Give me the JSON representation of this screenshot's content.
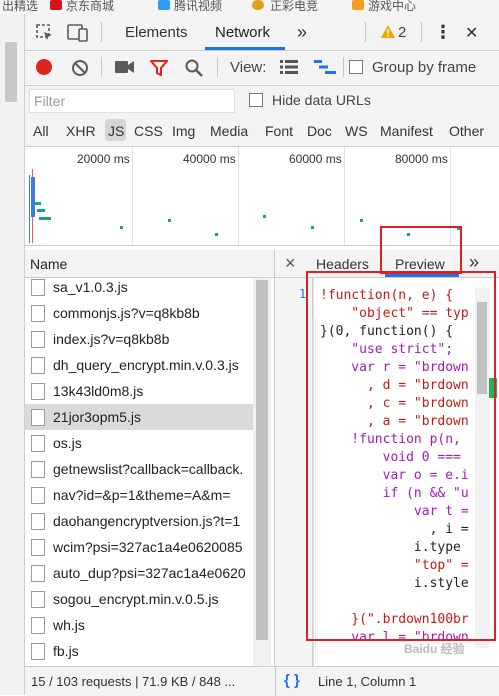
{
  "bookmarks": [
    {
      "label": "出精选",
      "color": "#999999"
    },
    {
      "label": "京东商城",
      "color": "#d4141e"
    },
    {
      "label": "腾讯视频",
      "color": "#2f9cf0"
    },
    {
      "label": "正彩电竞",
      "color": "#e0a21b"
    },
    {
      "label": "游戏中心",
      "color": "#f0a020"
    }
  ],
  "devtools": {
    "tabs": [
      "Elements",
      "Network"
    ],
    "active_tab": "Network",
    "more": "»",
    "warning_count": "2",
    "menu": "⋮",
    "close": "✕"
  },
  "network_toolbar": {
    "view_label": "View:",
    "group_by_frame": "Group by frame"
  },
  "filter": {
    "placeholder": "Filter",
    "hide_data_urls": "Hide data URLs"
  },
  "types": [
    "All",
    "XHR",
    "JS",
    "CSS",
    "Img",
    "Media",
    "Font",
    "Doc",
    "WS",
    "Manifest",
    "Other"
  ],
  "active_type": "JS",
  "overview": {
    "ticks": [
      "20000 ms",
      "40000 ms",
      "60000 ms",
      "80000 ms"
    ]
  },
  "name_column": "Name",
  "requests": [
    "sa_v1.0.3.js",
    "commonjs.js?v=q8kb8b",
    "index.js?v=q8kb8b",
    "dh_query_encrypt.min.v.0.3.js",
    "13k43ld0m8.js",
    "21jor3opm5.js",
    "os.js",
    "getnewslist?callback=callback.",
    "nav?id=&p=1&theme=A&m=",
    "daohangencryptversion.js?t=1",
    "wcim?psi=327ac1a4e0620085",
    "auto_dup?psi=327ac1a4e0620",
    "sogou_encrypt.min.v.0.5.js",
    "wh.js",
    "fb.js"
  ],
  "selected_request": "21jor3opm5.js",
  "detail_tabs": {
    "close": "×",
    "headers": "Headers",
    "preview": "Preview",
    "more": "»"
  },
  "code": {
    "line_number": "1",
    "lines": [
      "!function(n, e) {",
      "    \"object\" == typ",
      "}(0, function() {",
      "    \"use strict\";",
      "    var r = \"brdown",
      "      , d = \"brdown",
      "      , c = \"brdown",
      "      , a = \"brdown",
      "    !function p(n,",
      "        void 0 ===",
      "        var o = e.i",
      "        if (n && \"u",
      "            var t =",
      "              , i =",
      "            i.type",
      "            \"top\" =",
      "            i.style",
      "    }(\".brdown100br",
      "    var l = \"brdown"
    ]
  },
  "status": {
    "summary": "15 / 103 requests | 71.9 KB / 848 ...",
    "braces": "{ }",
    "position": "Line 1, Column 1"
  },
  "watermark": "Baidu 经验",
  "colors": {
    "accent": "#1a73e8",
    "record": "#e0231c",
    "highlight": "#e02020",
    "keyword": "#a31bb7",
    "string": "#c41a16"
  }
}
